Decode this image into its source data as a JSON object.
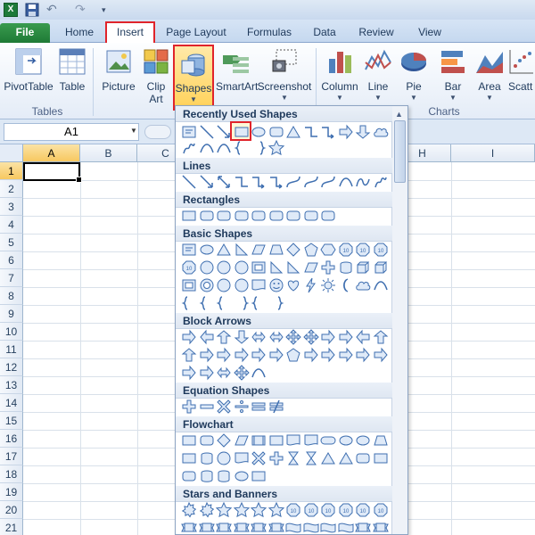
{
  "quick_access": {
    "app_icon": "excel-icon",
    "save_icon": "save-icon",
    "undo_icon": "undo-icon",
    "redo_icon": "redo-icon"
  },
  "tabs": {
    "file": "File",
    "home": "Home",
    "insert": "Insert",
    "page_layout": "Page Layout",
    "formulas": "Formulas",
    "data": "Data",
    "review": "Review",
    "view": "View"
  },
  "ribbon": {
    "pivottable": "PivotTable",
    "table": "Table",
    "picture": "Picture",
    "clip_art_1": "Clip",
    "clip_art_2": "Art",
    "shapes": "Shapes",
    "smartart": "SmartArt",
    "screenshot": "Screenshot",
    "column": "Column",
    "line": "Line",
    "pie": "Pie",
    "bar": "Bar",
    "area": "Area",
    "scatter": "Scatt",
    "group_tables": "Tables",
    "group_charts": "Charts"
  },
  "formula_bar": {
    "name_box": "A1"
  },
  "grid": {
    "columns": [
      "A",
      "B",
      "C",
      "H",
      "I"
    ],
    "rows": [
      "1",
      "2",
      "3",
      "4",
      "5",
      "6",
      "7",
      "8",
      "9",
      "10",
      "11",
      "12",
      "13",
      "14",
      "15",
      "16",
      "17",
      "18",
      "19",
      "20",
      "21"
    ]
  },
  "gallery": {
    "sections": {
      "recent": "Recently Used Shapes",
      "lines": "Lines",
      "rectangles": "Rectangles",
      "basic": "Basic Shapes",
      "block_arrows": "Block Arrows",
      "equation": "Equation Shapes",
      "flowchart": "Flowchart",
      "stars": "Stars and Banners"
    }
  },
  "colors": {
    "accent_red": "#e0242b",
    "excel_green": "#1e7a35",
    "ribbon_blue": "#dde8f5"
  }
}
